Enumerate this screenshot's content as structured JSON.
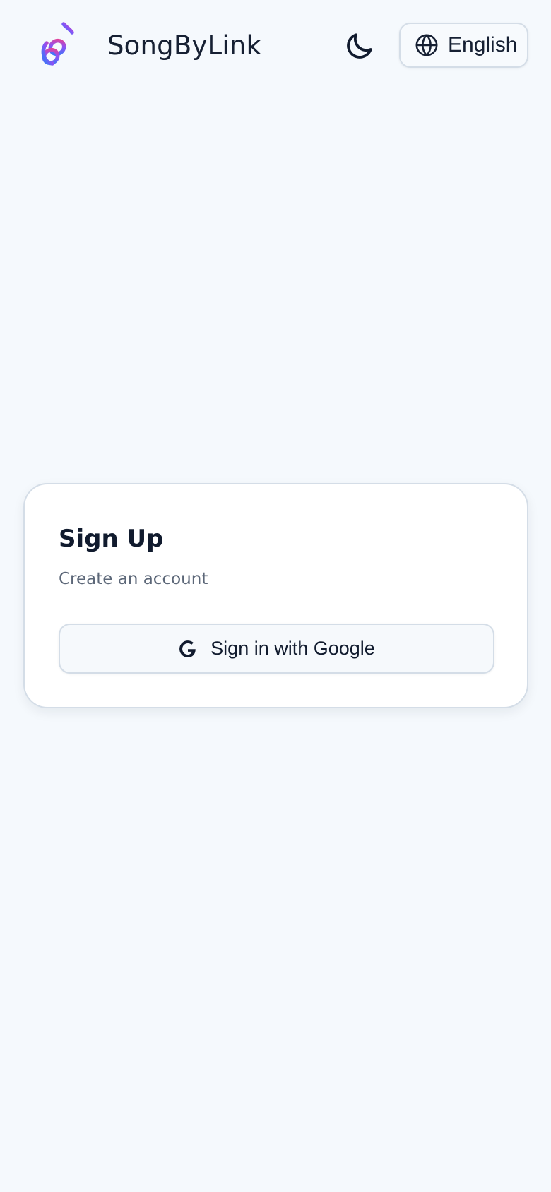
{
  "header": {
    "app_title": "SongByLink",
    "logo_icon": "music-link-waveform-logo",
    "theme_toggle_icon": "moon-icon",
    "language": {
      "label": "English",
      "icon": "globe-icon"
    }
  },
  "signup": {
    "title": "Sign Up",
    "subtitle": "Create an account",
    "google_button": {
      "label": "Sign in with Google",
      "icon": "google-icon"
    }
  },
  "colors": {
    "background": "#f5f9fd",
    "card": "#ffffff",
    "border": "#d4dde7",
    "text": "#111b2e",
    "muted_text": "#5c6778",
    "logo_gradient": [
      "#2f7df6",
      "#8d52f5",
      "#ee3f8d"
    ]
  }
}
